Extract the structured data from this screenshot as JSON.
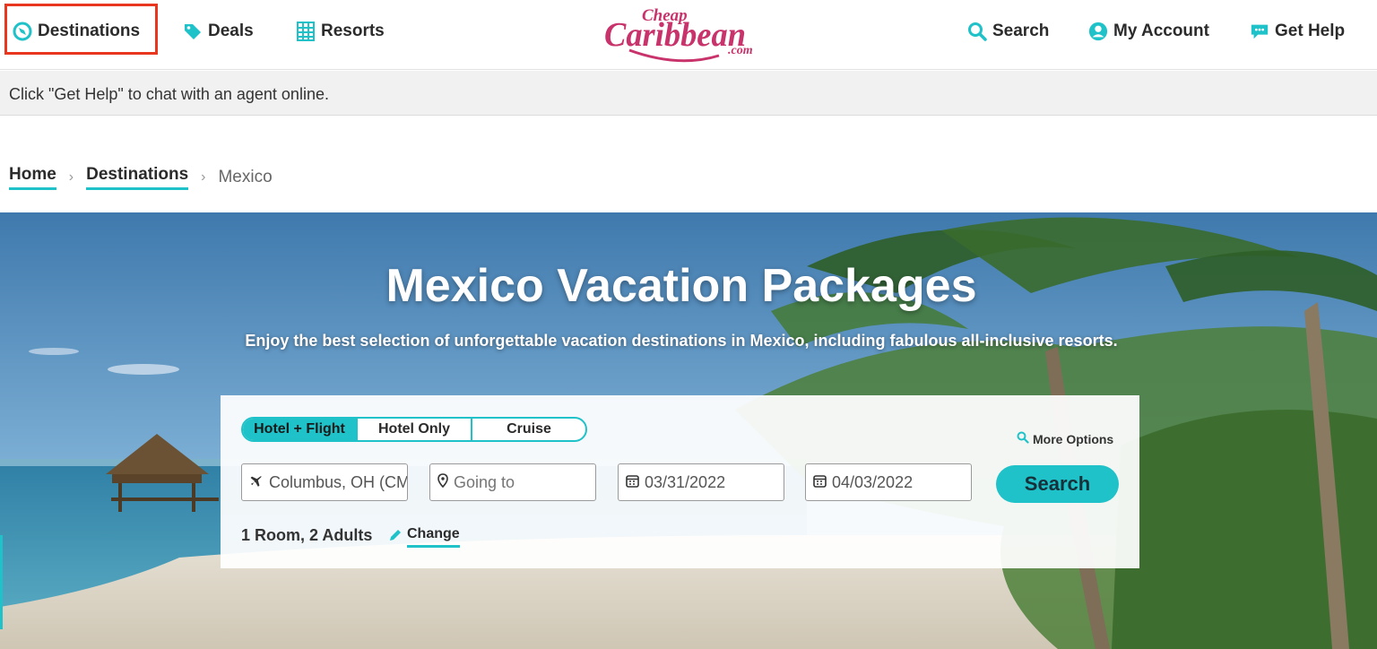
{
  "nav": {
    "destinations": "Destinations",
    "deals": "Deals",
    "resorts": "Resorts",
    "search": "Search",
    "my_account": "My Account",
    "get_help": "Get Help"
  },
  "logo": {
    "line1": "Cheap",
    "line2": "Caribbean",
    "line3": ".com"
  },
  "info_bar": {
    "text": "Click \"Get Help\" to chat with an agent online."
  },
  "breadcrumb": {
    "home": "Home",
    "destinations": "Destinations",
    "current": "Mexico"
  },
  "hero": {
    "title": "Mexico Vacation Packages",
    "subtitle": "Enjoy the best selection of unforgettable vacation destinations in Mexico, including fabulous all-inclusive resorts."
  },
  "search_form": {
    "tabs": [
      "Hotel + Flight",
      "Hotel Only",
      "Cruise"
    ],
    "active_tab": "Hotel + Flight",
    "more_options": "More Options",
    "from_value": "Columbus, OH (CMH)",
    "to_placeholder": "Going to",
    "depart_date": "03/31/2022",
    "return_date": "04/03/2022",
    "search_label": "Search",
    "rooms_text": "1 Room, 2 Adults",
    "change_label": "Change"
  },
  "colors": {
    "accent": "#1ec2c8",
    "logo": "#c8336b",
    "highlight": "#e8361f"
  }
}
